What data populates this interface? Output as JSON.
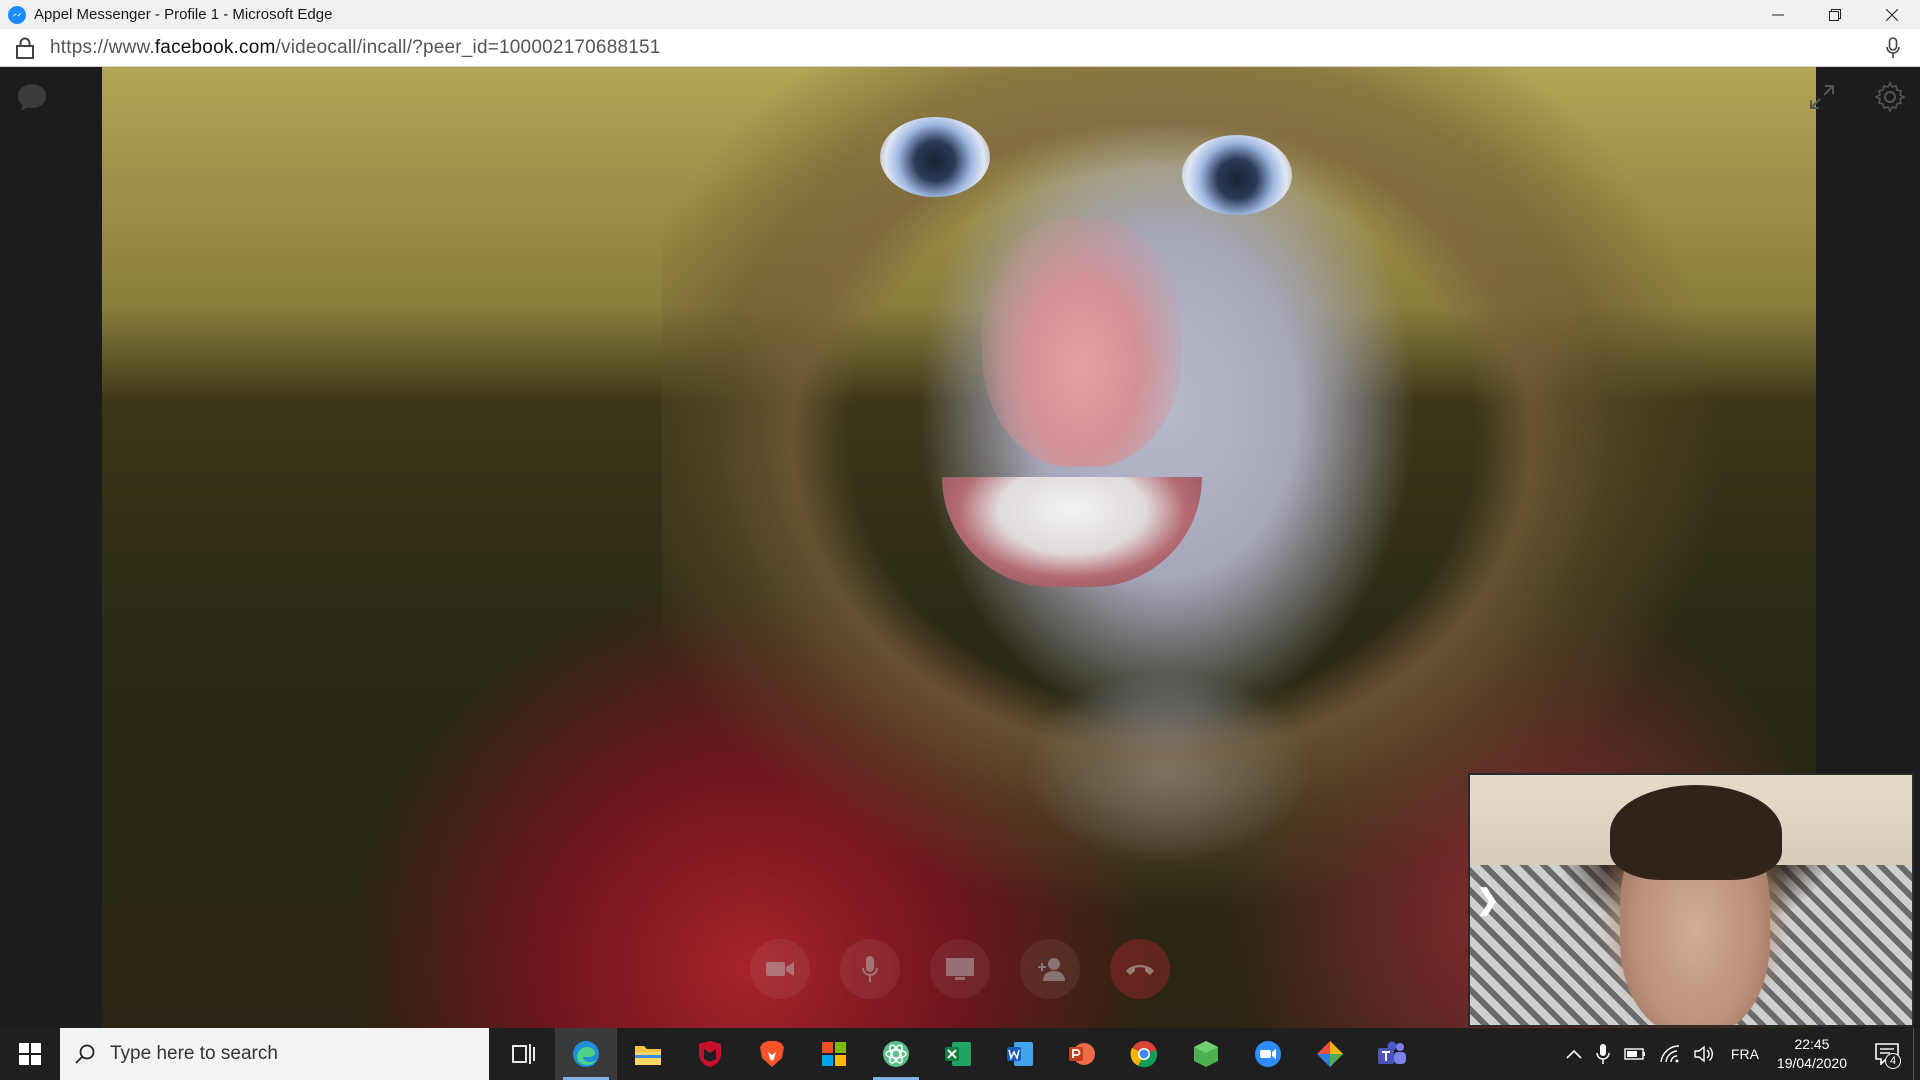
{
  "window": {
    "title": "Appel Messenger - Profile 1 - Microsoft Edge",
    "controls": [
      "minimize-icon",
      "restore-icon",
      "close-icon"
    ]
  },
  "addressbar": {
    "url_prefix": "https://www.",
    "url_domain": "facebook.com",
    "url_path": "/videocall/incall/?peer_id=100002170688151"
  },
  "call": {
    "controls": [
      "video-camera-icon",
      "microphone-icon",
      "screen-share-icon",
      "add-person-icon",
      "end-call-icon"
    ],
    "self_view_toggle": "❯"
  },
  "taskbar": {
    "search_placeholder": "Type here to search",
    "apps": [
      "task-view-icon",
      "edge-icon",
      "file-explorer-icon",
      "mcafee-icon",
      "brave-icon",
      "microsoft-store-icon",
      "atom-app-icon",
      "excel-icon",
      "word-icon",
      "powerpoint-icon",
      "chrome-icon",
      "green-cube-app-icon",
      "zoom-icon",
      "photos-app-icon",
      "teams-icon"
    ],
    "tray": {
      "language": "FRA",
      "time": "22:45",
      "date": "19/04/2020",
      "notification_count": "4"
    }
  },
  "colors": {
    "accent": "#1a8cff",
    "taskbar": "#1f1f1f",
    "end_call": "#dc283c"
  }
}
